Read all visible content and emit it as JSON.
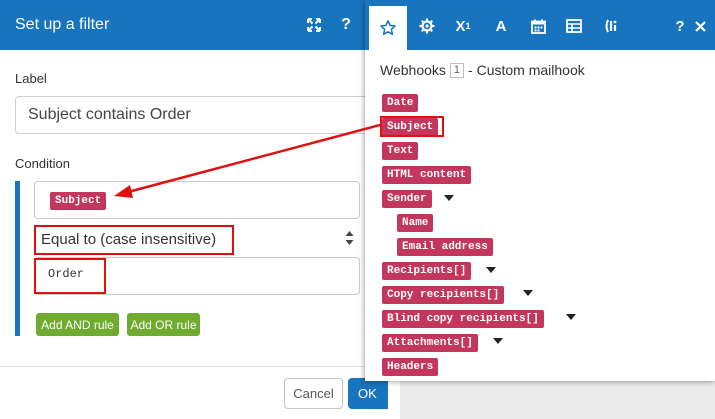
{
  "filter_dialog": {
    "title": "Set up a filter",
    "label_caption": "Label",
    "label_value": "Subject contains Order",
    "condition_caption": "Condition",
    "condition_field_pill": "Subject",
    "operator": "Equal to (case insensitive)",
    "operator_arrow": "▲\n▼",
    "value": "Order",
    "add_and_rule": "Add AND rule",
    "add_or_rule": "Add OR rule",
    "cancel": "Cancel",
    "ok": "OK"
  },
  "mapping_panel": {
    "module_prefix": "Webhooks",
    "module_number": "1",
    "module_suffix": "- Custom mailhook",
    "tabs": [
      "favorites-icon",
      "functions-icon",
      "math-icon",
      "text-icon",
      "date-icon",
      "array-icon",
      "custom-icon"
    ],
    "variables": [
      {
        "label": "Date"
      },
      {
        "label": "Subject"
      },
      {
        "label": "Text"
      },
      {
        "label": "HTML content"
      },
      {
        "label": "Sender"
      },
      {
        "label": "Name"
      },
      {
        "label": "Email address"
      },
      {
        "label": "Recipients[]"
      },
      {
        "label": "Copy recipients[]"
      },
      {
        "label": "Blind copy recipients[]"
      },
      {
        "label": "Attachments[]"
      },
      {
        "label": "Headers"
      }
    ]
  },
  "colors": {
    "header_blue": "#1874bf",
    "pill_red": "#c4365b",
    "button_green": "#6eab2f",
    "annotation_red": "#e20f0f"
  }
}
